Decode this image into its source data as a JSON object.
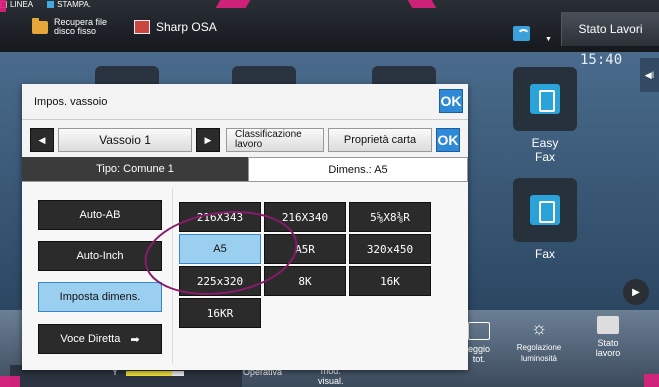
{
  "topbar": {
    "recupera_line1": "Recupera file",
    "recupera_line2": "disco fisso",
    "sharp_osa": "Sharp OSA",
    "linea": "LINEA",
    "stampa": "STAMPA.",
    "stato_lavori": "Stato Lavori"
  },
  "home": {
    "clock": "15:40",
    "side_tab": "◀I",
    "easy_fax_line1": "Easy",
    "easy_fax_line2": "Fax",
    "fax": "Fax"
  },
  "bottombar": {
    "operativa": "Operativa",
    "mod_visual_line1": "mod.",
    "mod_visual_line2": "visual.",
    "conteggio_line1": "eggio",
    "conteggio_line2": "tot.",
    "regolazione_line1": "Regolazione",
    "regolazione_line2": "luminosità",
    "stato_lavoro_line1": "Stato",
    "stato_lavoro_line2": "lavoro",
    "toner_label": "Y"
  },
  "dialog": {
    "title": "Impos. vassoio",
    "ok": "OK",
    "prev_arrow": "◀",
    "next_arrow": "▶",
    "vassoio": "Vassoio 1",
    "classificazione_line1": "Classificazione",
    "classificazione_line2": "lavoro",
    "proprieta_carta": "Proprietà carta",
    "tab_tipo": "Tipo: Comune 1",
    "tab_dimens": "Dimens.: A5",
    "left_buttons": [
      "Auto-AB",
      "Auto-Inch",
      "Imposta dimens.",
      "Voce Diretta"
    ],
    "voce_arrow": "➡",
    "sizes": [
      "216X343",
      "216X340",
      "5⅝X8⅜R",
      "A5",
      "A5R",
      "320x450",
      "225x320",
      "8K",
      "16K",
      "16KR"
    ]
  }
}
